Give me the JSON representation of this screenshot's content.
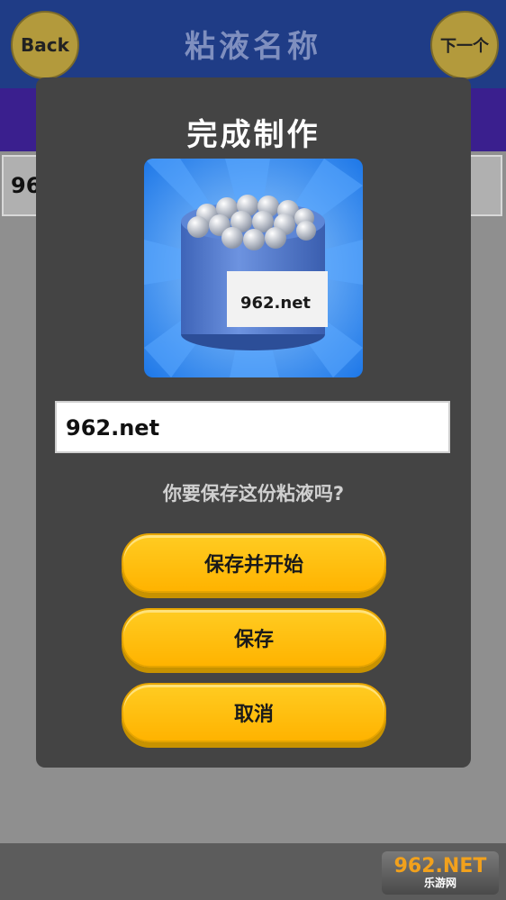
{
  "header": {
    "title": "粘液名称",
    "back_label": "Back",
    "next_label": "下一个"
  },
  "background_input": {
    "value": "962"
  },
  "modal": {
    "title": "完成制作",
    "jar_label": "962.net",
    "name_input_value": "962.net",
    "question": "你要保存这份粘液吗?",
    "buttons": {
      "save_and_start": "保存并开始",
      "save": "保存",
      "cancel": "取消"
    }
  },
  "watermark": {
    "top": "962.NET",
    "bottom": "乐游网"
  },
  "colors": {
    "accent": "#ffb300",
    "header": "#1f3c86",
    "modal_bg": "#444444"
  }
}
